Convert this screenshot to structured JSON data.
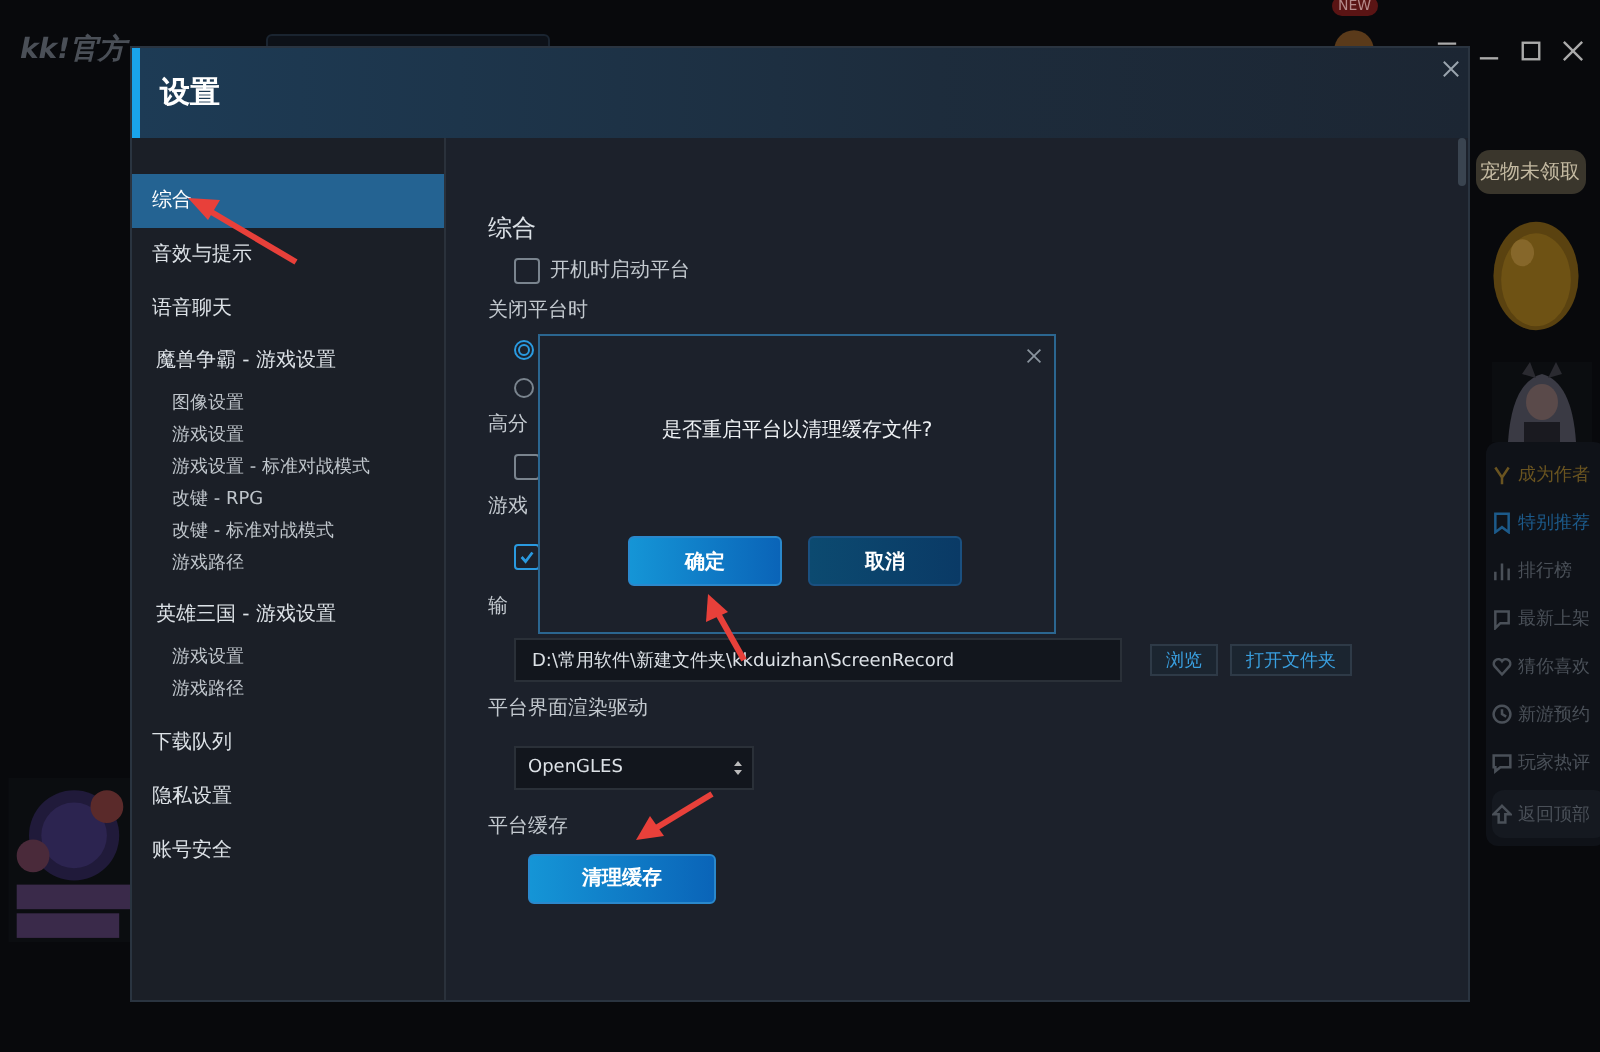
{
  "background_app": {
    "logo": "kk!官方",
    "new_badge": "NEW",
    "pet_bubble": "宠物未领取",
    "side_menu": [
      {
        "kind": "promo",
        "label": "成为作者",
        "selected": false
      },
      {
        "kind": "link",
        "label": "特别推荐",
        "selected": true
      },
      {
        "kind": "link",
        "label": "排行榜",
        "selected": false
      },
      {
        "kind": "link",
        "label": "最新上架",
        "selected": false
      },
      {
        "kind": "link",
        "label": "猜你喜欢",
        "selected": false
      },
      {
        "kind": "link",
        "label": "新游预约",
        "selected": false
      },
      {
        "kind": "link",
        "label": "玩家热评",
        "selected": false
      },
      {
        "kind": "top",
        "label": "返回顶部",
        "selected": false
      }
    ]
  },
  "dialog": {
    "title": "设置",
    "nav": [
      {
        "label": "综合",
        "selected": true
      },
      {
        "label": "音效与提示",
        "selected": false
      },
      {
        "label": "语音聊天",
        "selected": false
      },
      {
        "label": "魔兽争霸 - 游戏设置",
        "selected": false,
        "children": [
          {
            "label": "图像设置"
          },
          {
            "label": "游戏设置"
          },
          {
            "label": "游戏设置 - 标准对战模式"
          },
          {
            "label": "改键 - RPG"
          },
          {
            "label": "改键 - 标准对战模式"
          },
          {
            "label": "游戏路径"
          }
        ]
      },
      {
        "label": "英雄三国 - 游戏设置",
        "selected": false,
        "children": [
          {
            "label": "游戏设置"
          },
          {
            "label": "游戏路径"
          }
        ]
      },
      {
        "label": "下载队列",
        "selected": false
      },
      {
        "label": "隐私设置",
        "selected": false
      },
      {
        "label": "账号安全",
        "selected": false
      }
    ],
    "content": [
      {
        "kind": "heading",
        "text": "综合"
      },
      {
        "kind": "checkbox",
        "label": "开机时启动平台",
        "checked": false
      },
      {
        "kind": "label",
        "text": "关闭平台时"
      },
      {
        "kind": "radio",
        "selected": true
      },
      {
        "kind": "radio",
        "selected": false
      },
      {
        "kind": "label",
        "text": "高分"
      },
      {
        "kind": "checkbox",
        "checked": false
      },
      {
        "kind": "label",
        "text": "游戏"
      },
      {
        "kind": "checkbox",
        "checked": true
      },
      {
        "kind": "label",
        "text": "输"
      },
      {
        "kind": "path",
        "value": "D:\\常用软件\\新建文件夹\\kkduizhan\\ScreenRecord",
        "buttons": [
          "浏览",
          "打开文件夹"
        ]
      },
      {
        "kind": "label",
        "text": "平台界面渲染驱动"
      },
      {
        "kind": "select",
        "value": "OpenGLES"
      },
      {
        "kind": "label",
        "text": "平台缓存"
      },
      {
        "kind": "button",
        "label": "清理缓存"
      }
    ],
    "confirm": {
      "message": "是否重启平台以清理缓存文件?",
      "buttons": [
        {
          "kind": "primary",
          "label": "确定"
        },
        {
          "kind": "secondary",
          "label": "取消"
        }
      ]
    }
  }
}
